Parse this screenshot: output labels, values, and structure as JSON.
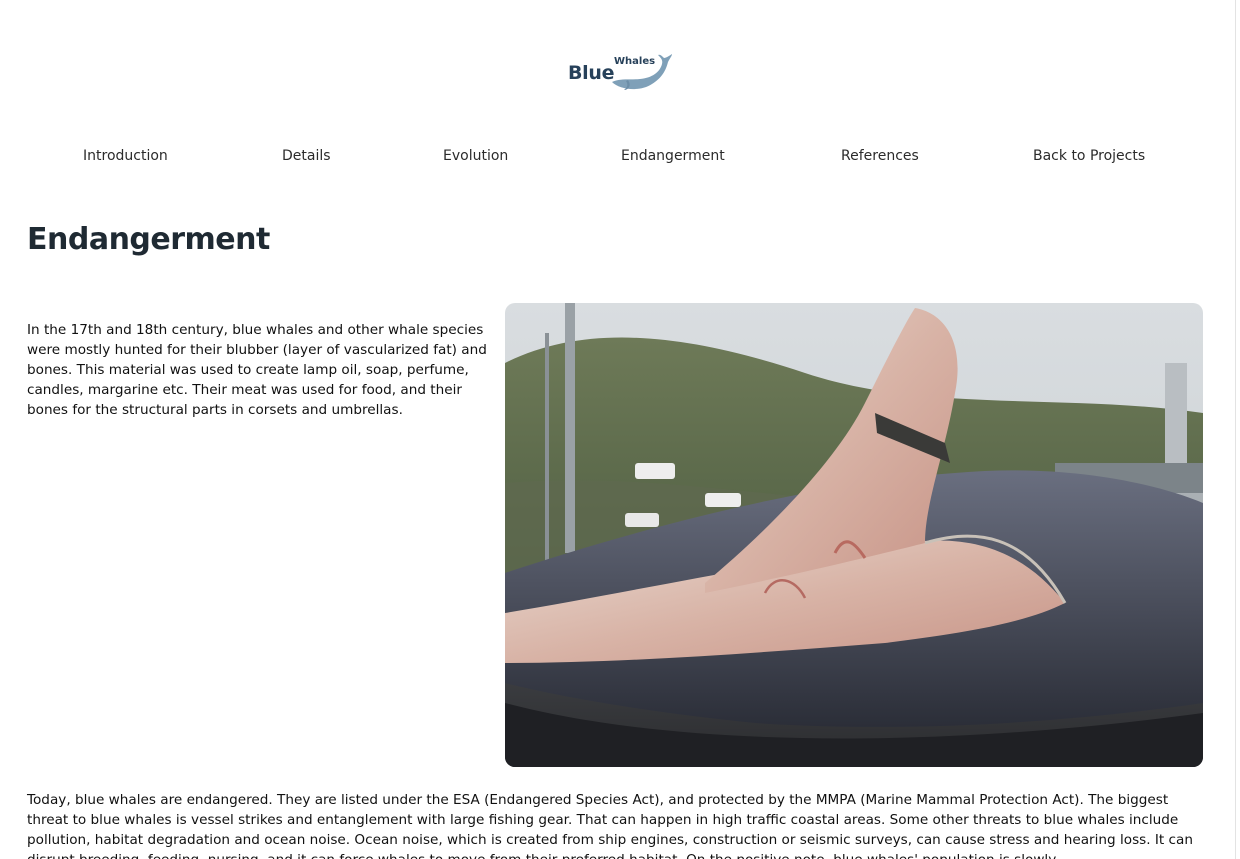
{
  "logo": {
    "main": "Blue",
    "sub": "Whales"
  },
  "nav": {
    "items": [
      {
        "label": "Introduction"
      },
      {
        "label": "Details"
      },
      {
        "label": "Evolution"
      },
      {
        "label": "Endangerment"
      },
      {
        "label": "References"
      },
      {
        "label": "Back to Projects"
      }
    ]
  },
  "section": {
    "title": "Endangerment",
    "intro": "In the 17th and 18th century, blue whales and other whale species were mostly hunted for their blubber (layer of vascularized fat) and bones. This material was used to create lamp oil, soap, perfume, candles, margarine etc. Their meat was used for food, and their bones for the structural parts in corsets and umbrellas.",
    "body": "Today, blue whales are endangered. They are listed under the ESA (Endangered Species Act), and protected by the MMPA (Marine Mammal Protection Act). The biggest threat to blue whales is vessel strikes and entanglement with large fishing gear. That can happen in high traffic coastal areas. Some other threats to blue whales include pollution, habitat degradation and ocean noise. Ocean noise, which is created from ship engines, construction or seismic surveys, can cause stress and hearing loss. It can disrupt breeding, feeding, nursing, and it can force whales to move from their preferred habitat. On the positive note, blue whales' population is slowly"
  },
  "colors": {
    "logo_text": "#27415a",
    "logo_whale": "#7fa0b8",
    "heading": "#1f2a33"
  }
}
